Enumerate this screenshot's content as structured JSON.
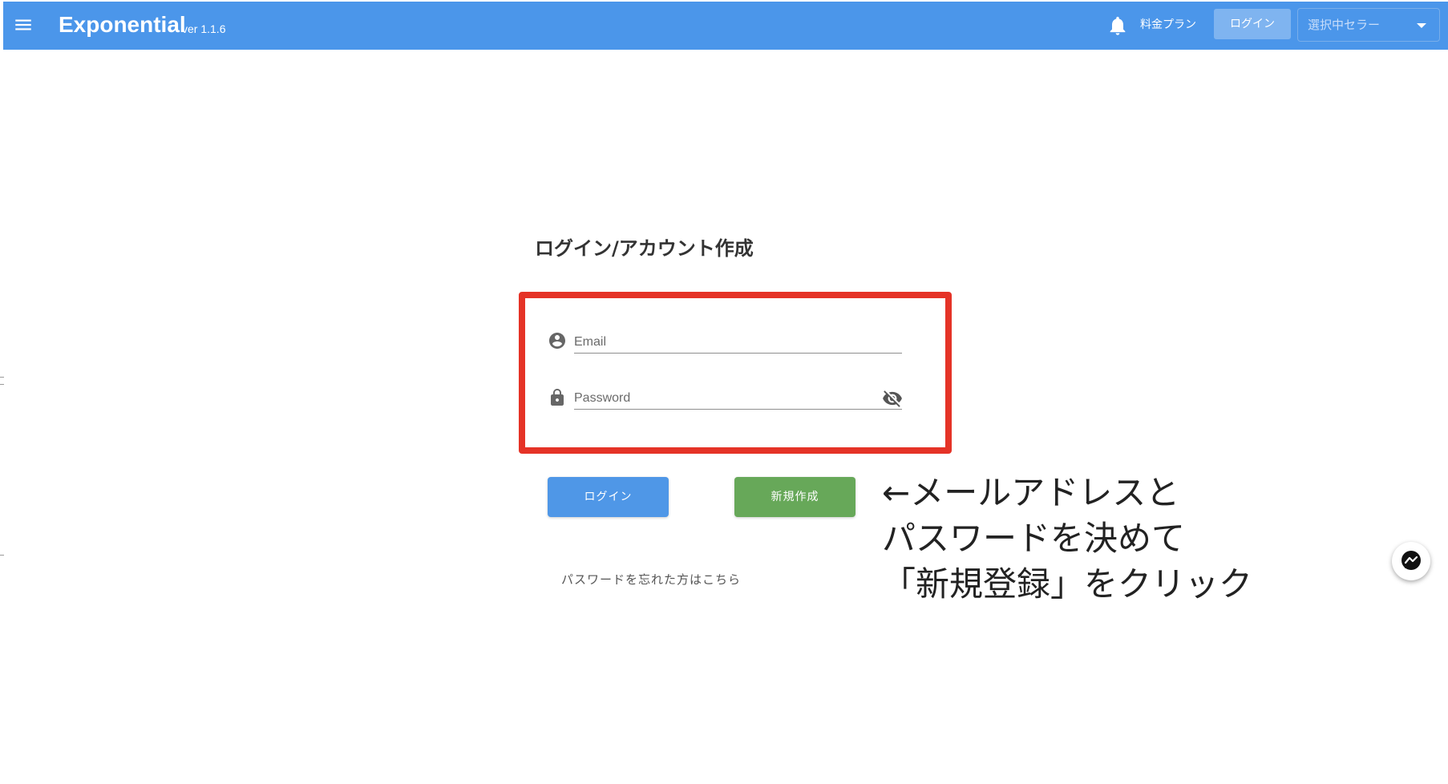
{
  "header": {
    "title": "Exponential",
    "version": "ver 1.1.6",
    "pricing_label": "料金プラン",
    "login_label": "ログイン",
    "seller_select_value": "選択中セラー"
  },
  "main": {
    "heading": "ログイン/アカウント作成",
    "email_placeholder": "Email",
    "password_placeholder": "Password",
    "login_button": "ログイン",
    "create_button": "新規作成",
    "forgot_password": "パスワードを忘れた方はこちら"
  },
  "annotation": {
    "lines": [
      "←メールアドレスと",
      "パスワードを決めて",
      "「新規登録」をクリック"
    ]
  },
  "icons": {
    "menu": "menu-icon",
    "bell": "bell-icon",
    "account": "account-circle-icon",
    "lock": "lock-icon",
    "visibility": "eye-off-icon",
    "chat": "messenger-icon"
  },
  "colors": {
    "appbar": "#4b96ea",
    "highlight": "#e53327",
    "login_button": "#4f97e7",
    "create_button": "#67a859"
  }
}
